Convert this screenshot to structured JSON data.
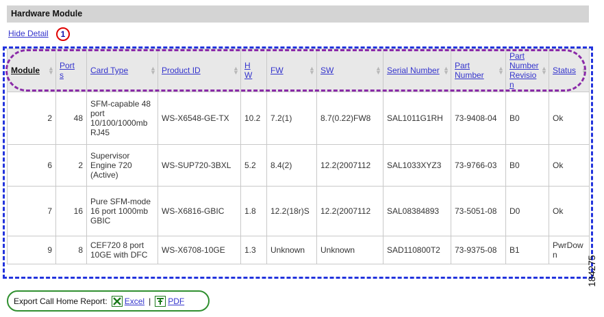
{
  "section": {
    "title": "Hardware Module"
  },
  "hide_detail": {
    "label": "Hide Detail"
  },
  "callout": {
    "number": "1"
  },
  "table": {
    "sorted_column": "Module",
    "columns": [
      "Module",
      "Ports",
      "Card Type",
      "Product ID",
      "HW",
      "FW",
      "SW",
      "Serial Number",
      "Part Number",
      "Part Number Revision",
      "Status"
    ],
    "rows": [
      [
        "2",
        "48",
        "SFM-capable 48 port 10/100/1000mb RJ45",
        "WS-X6548-GE-TX",
        "10.2",
        "7.2(1)",
        "8.7(0.22)FW8",
        "SAL1011G1RH",
        "73-9408-04",
        "B0",
        "Ok"
      ],
      [
        "6",
        "2",
        "Supervisor Engine 720 (Active)",
        "WS-SUP720-3BXL",
        "5.2",
        "8.4(2)",
        "12.2(2007112",
        "SAL1033XYZ3",
        "73-9766-03",
        "B0",
        "Ok"
      ],
      [
        "7",
        "16",
        "Pure SFM-mode 16 port 1000mb GBIC",
        "WS-X6816-GBIC",
        "1.8",
        "12.2(18r)S",
        "12.2(2007112",
        "SAL08384893",
        "73-5051-08",
        "D0",
        "Ok"
      ],
      [
        "9",
        "8",
        "CEF720 8 port 10GE with DFC",
        "WS-X6708-10GE",
        "1.3",
        "Unknown",
        "Unknown",
        "SAD110800T2",
        "73-9375-08",
        "B1",
        "PwrDown"
      ]
    ]
  },
  "export": {
    "label": "Export Call Home Report:",
    "excel_label": "Excel",
    "separator": "|",
    "pdf_label": "PDF"
  },
  "figure_id": "184275",
  "colors": {
    "table_outline": "#2233dd",
    "header_outline": "#8a2aa8",
    "export_outline": "#2f8f2f",
    "callout_circle": "#e00000",
    "link": "#3333cc"
  }
}
